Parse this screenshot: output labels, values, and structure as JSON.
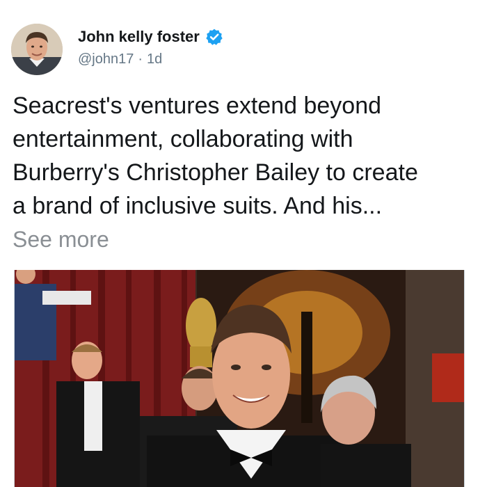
{
  "tweet": {
    "author_name": "John kelly foster",
    "handle": "@john17",
    "separator": "·",
    "age": "1d",
    "text": "Seacrest's ventures extend beyond\nentertainment, collaborating with\nBurberry's Christopher Bailey to create\na brand of inclusive suits. And his...",
    "see_more": "See more"
  },
  "icons": {
    "verified": "verified-badge-icon",
    "avatar": "profile-photo"
  },
  "colors": {
    "verified_blue": "#1da1f2",
    "secondary_text": "#657786",
    "see_more_gray": "#8a8f94"
  }
}
